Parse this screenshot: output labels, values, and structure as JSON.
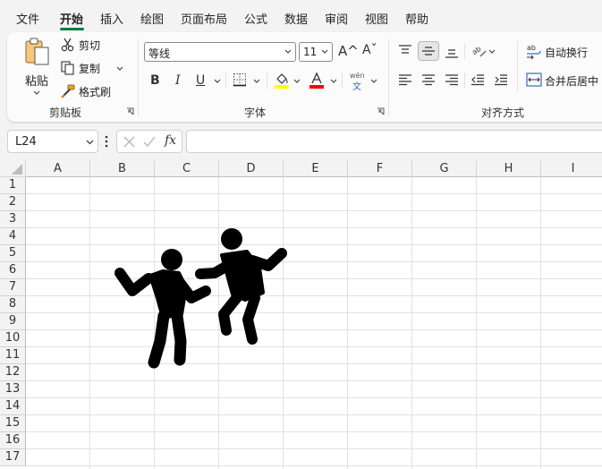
{
  "menu": {
    "tabs": [
      "文件",
      "开始",
      "插入",
      "绘图",
      "页面布局",
      "公式",
      "数据",
      "审阅",
      "视图",
      "帮助"
    ],
    "active": "开始"
  },
  "clipboard": {
    "paste": "粘贴",
    "cut": "剪切",
    "copy": "复制",
    "format_painter": "格式刷",
    "label": "剪贴板"
  },
  "font": {
    "name": "等线",
    "size": "11",
    "increase": "A^",
    "decrease": "Aˇ",
    "bold": "B",
    "italic": "I",
    "underline": "U",
    "fill_color": "#ffff00",
    "font_color": "#ff0000",
    "phonetic_top": "wén",
    "phonetic_bottom": "文",
    "label": "字体"
  },
  "alignment": {
    "wrap_text": "自动换行",
    "merge_center": "合并后居中",
    "label": "对齐方式"
  },
  "formula_bar": {
    "name_box": "L24",
    "fx": "fx",
    "formula": ""
  },
  "grid": {
    "columns": [
      "A",
      "B",
      "C",
      "D",
      "E",
      "F",
      "G",
      "H",
      "I"
    ],
    "rows": [
      "1",
      "2",
      "3",
      "4",
      "5",
      "6",
      "7",
      "8",
      "9",
      "10",
      "11",
      "12",
      "13",
      "14",
      "15",
      "16",
      "17"
    ]
  },
  "colors": {
    "accent": "#107c41",
    "icon_fill": "#000000"
  }
}
